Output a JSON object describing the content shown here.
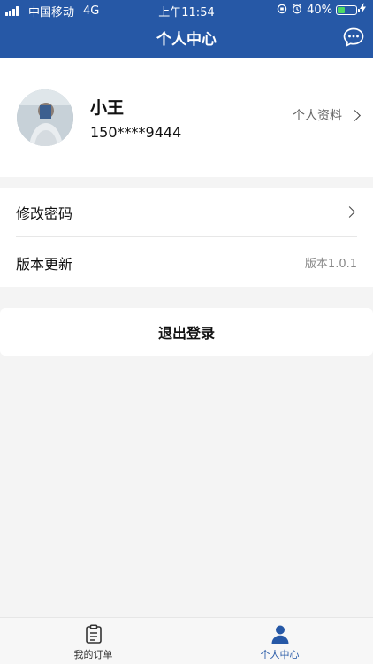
{
  "status_bar": {
    "carrier": "中国移动",
    "network": "4G",
    "time": "上午11:54",
    "battery": "40%",
    "battery_level": 0.4
  },
  "header": {
    "title": "个人中心",
    "right_icon": "chat-bubble-icon"
  },
  "profile": {
    "name": "小王",
    "phone": "150****9444",
    "link_label": "个人资料"
  },
  "settings": {
    "change_password": "修改密码",
    "version_update": "版本更新",
    "version_value": "版本1.0.1"
  },
  "logout": {
    "label": "退出登录"
  },
  "tabbar": {
    "tabs": [
      {
        "label": "我的订单",
        "icon": "clipboard-icon"
      },
      {
        "label": "个人中心",
        "icon": "person-icon"
      }
    ],
    "active_index": 1
  },
  "colors": {
    "primary": "#2658a6",
    "background": "#f4f4f4",
    "battery_green": "#4cd964"
  }
}
